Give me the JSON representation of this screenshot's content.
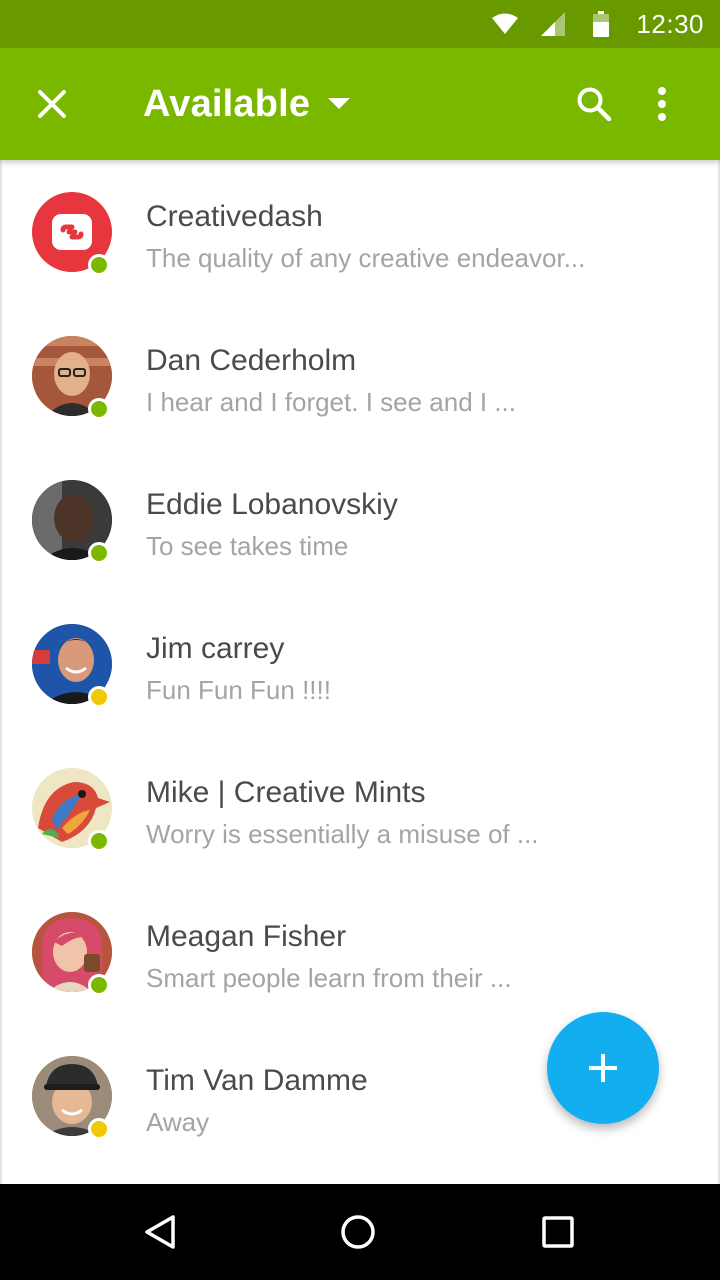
{
  "status_bar": {
    "time": "12:30",
    "icons": [
      "wifi-icon",
      "signal-icon",
      "battery-icon"
    ]
  },
  "app_bar": {
    "title": "Available",
    "icons": [
      "close-icon",
      "dropdown-arrow-icon",
      "search-icon",
      "more-vert-icon"
    ],
    "color": "#7ab800"
  },
  "contacts": [
    {
      "name": "Creativedash",
      "message": "The quality of any creative endeavor...",
      "status": "online"
    },
    {
      "name": "Dan Cederholm",
      "message": "I hear and I forget. I see and I ...",
      "status": "online"
    },
    {
      "name": "Eddie Lobanovskiy",
      "message": "To see takes time",
      "status": "online"
    },
    {
      "name": "Jim carrey",
      "message": "Fun Fun Fun !!!!",
      "status": "away"
    },
    {
      "name": "Mike | Creative Mints",
      "message": "Worry is essentially a misuse of ...",
      "status": "online"
    },
    {
      "name": "Meagan Fisher",
      "message": "Smart people learn from their ...",
      "status": "online"
    },
    {
      "name": "Tim Van Damme",
      "message": "Away",
      "status": "away"
    }
  ],
  "status_colors": {
    "online": "#7cb800",
    "away": "#f2c800"
  },
  "fab": {
    "icon": "plus-icon",
    "color": "#12aef0"
  },
  "nav_bar": {
    "icons": [
      "back-icon",
      "home-icon",
      "recents-icon"
    ]
  }
}
